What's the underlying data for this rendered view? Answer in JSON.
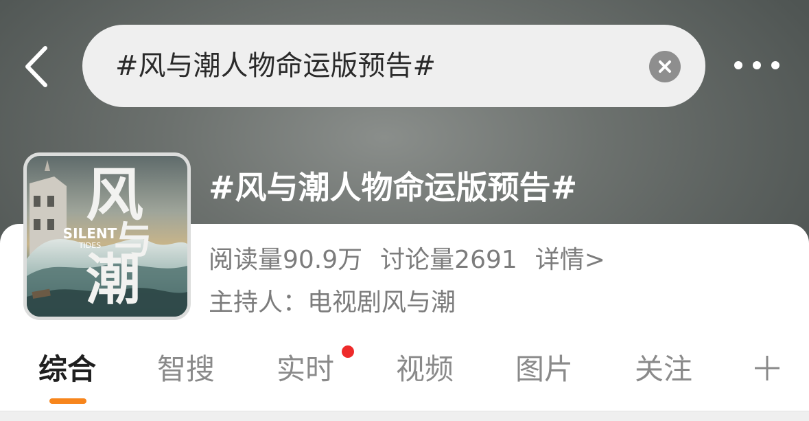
{
  "search": {
    "query": "#风与潮人物命运版预告#"
  },
  "topic": {
    "title": "#风与潮人物命运版预告#",
    "cover": {
      "title_line1": "风",
      "title_line2": "与",
      "title_line3": "潮",
      "english_title_1": "SILENT",
      "english_title_2": "TIDES"
    },
    "stats": {
      "reads": "阅读量90.9万",
      "discussions": "讨论量2691",
      "details_link": "详情>"
    },
    "host": "主持人：电视剧风与潮"
  },
  "tabs": [
    {
      "label": "综合",
      "active": true
    },
    {
      "label": "智搜",
      "active": false
    },
    {
      "label": "实时",
      "active": false,
      "badge": true
    },
    {
      "label": "视频",
      "active": false
    },
    {
      "label": "图片",
      "active": false
    },
    {
      "label": "关注",
      "active": false
    }
  ],
  "icons": {
    "back": "chevron-left-icon",
    "clear": "clear-icon",
    "more": "more-horizontal-icon",
    "add": "plus-icon"
  },
  "colors": {
    "accent": "#f7851c",
    "badge": "#ee2a2a",
    "header": "#6c716e"
  }
}
